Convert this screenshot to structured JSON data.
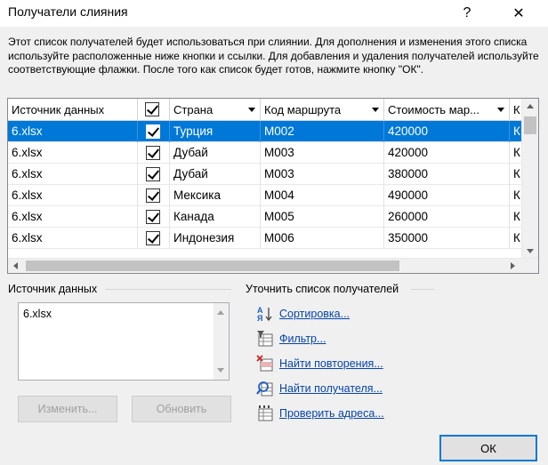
{
  "window": {
    "title": "Получатели слияния",
    "help_glyph": "?",
    "close_glyph": "✕"
  },
  "description": "Этот список получателей будет использоваться при слиянии. Для дополнения и изменения этого списка используйте расположенные ниже кнопки и ссылки. Для добавления и удаления получателей используйте соответствующие флажки. После того как список будет готов, нажмите кнопку \"ОК\".",
  "grid": {
    "columns": [
      "Источник данных",
      "",
      "Страна",
      "Код маршрута",
      "Стоимость мар...",
      "К"
    ],
    "rows": [
      {
        "source": "6.xlsx",
        "country": "Турция",
        "route": "M002",
        "cost": "420000",
        "k": "К",
        "selected": true
      },
      {
        "source": "6.xlsx",
        "country": "Дубай",
        "route": "M003",
        "cost": "420000",
        "k": "К"
      },
      {
        "source": "6.xlsx",
        "country": "Дубай",
        "route": "M003",
        "cost": "380000",
        "k": "К"
      },
      {
        "source": "6.xlsx",
        "country": "Мексика",
        "route": "M004",
        "cost": "490000",
        "k": "К"
      },
      {
        "source": "6.xlsx",
        "country": "Канада",
        "route": "M005",
        "cost": "260000",
        "k": "К"
      },
      {
        "source": "6.xlsx",
        "country": "Индонезия",
        "route": "M006",
        "cost": "350000",
        "k": "К"
      }
    ]
  },
  "data_source": {
    "label": "Источник данных",
    "items": [
      "6.xlsx"
    ],
    "edit_button": "Изменить...",
    "refresh_button": "Обновить"
  },
  "refine": {
    "label": "Уточнить список получателей",
    "links": [
      {
        "id": "sort",
        "text": "Сортировка...",
        "icon": "sort-icon"
      },
      {
        "id": "filter",
        "text": "Фильтр...",
        "icon": "filter-icon"
      },
      {
        "id": "duplicates",
        "text": "Найти повторения...",
        "icon": "duplicates-icon"
      },
      {
        "id": "find",
        "text": "Найти получателя...",
        "icon": "find-icon"
      },
      {
        "id": "validate",
        "text": "Проверить адреса...",
        "icon": "validate-icon"
      }
    ]
  },
  "ok_button": "ОК",
  "colors": {
    "selection": "#0078d7",
    "link": "#0645ad",
    "background": "#f0f0f0"
  }
}
